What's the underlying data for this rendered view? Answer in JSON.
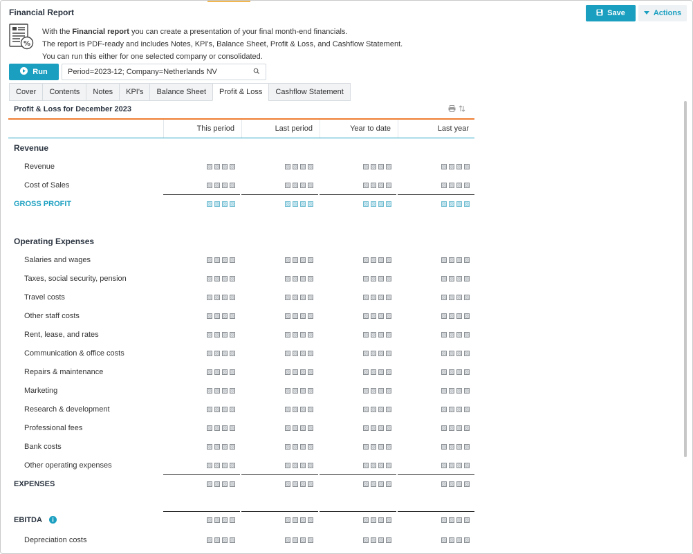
{
  "app": {
    "title": "Financial Report"
  },
  "toolbar": {
    "save_label": "Save",
    "actions_label": "Actions"
  },
  "intro": {
    "line1_prefix": "With the ",
    "line1_bold": "Financial report",
    "line1_suffix": " you can create a presentation of your final month-end financials.",
    "line2": "The report is PDF-ready and includes Notes, KPI's, Balance Sheet, Profit & Loss, and Cashflow Statement.",
    "line3": "You can run this either for one selected company or consolidated."
  },
  "run": {
    "label": "Run"
  },
  "parameters": {
    "value": "Period=2023-12; Company=Netherlands NV"
  },
  "tabs": [
    {
      "label": "Cover"
    },
    {
      "label": "Contents"
    },
    {
      "label": "Notes"
    },
    {
      "label": "KPI's"
    },
    {
      "label": "Balance Sheet"
    },
    {
      "label": "Profit & Loss",
      "active": true
    },
    {
      "label": "Cashflow Statement"
    }
  ],
  "sheet": {
    "title": "Profit & Loss for December 2023",
    "columns": [
      "This period",
      "Last period",
      "Year to date",
      "Last year"
    ]
  },
  "rows": [
    {
      "type": "head",
      "label": "Revenue"
    },
    {
      "type": "line",
      "label": "Revenue"
    },
    {
      "type": "line",
      "label": "Cost of Sales"
    },
    {
      "type": "gross",
      "label": "GROSS PROFIT"
    },
    {
      "type": "head",
      "label": "Operating Expenses"
    },
    {
      "type": "line",
      "label": "Salaries and wages"
    },
    {
      "type": "line",
      "label": "Taxes, social security, pension"
    },
    {
      "type": "line",
      "label": "Travel costs"
    },
    {
      "type": "line",
      "label": "Other staff costs"
    },
    {
      "type": "line",
      "label": "Rent, lease, and rates"
    },
    {
      "type": "line",
      "label": "Communication & office costs"
    },
    {
      "type": "line",
      "label": "Repairs & maintenance"
    },
    {
      "type": "line",
      "label": "Marketing"
    },
    {
      "type": "line",
      "label": "Research & development"
    },
    {
      "type": "line",
      "label": "Professional fees"
    },
    {
      "type": "line",
      "label": "Bank costs"
    },
    {
      "type": "line",
      "label": "Other operating expenses"
    },
    {
      "type": "total",
      "label": "EXPENSES"
    },
    {
      "type": "ebitda",
      "label": "EBITDA"
    },
    {
      "type": "line",
      "label": "Depreciation costs"
    }
  ]
}
